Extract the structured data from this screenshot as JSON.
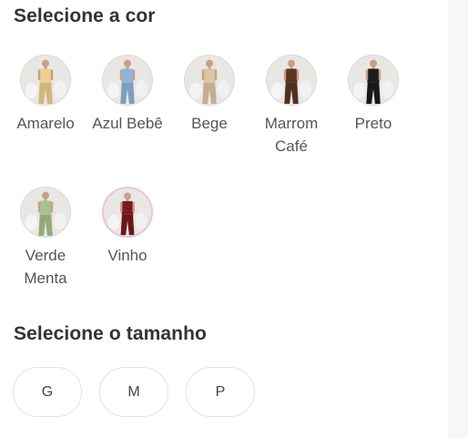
{
  "color_section": {
    "title": "Selecione a cor",
    "options": [
      {
        "label": "Amarelo",
        "color": "#ecd08e",
        "selected": false
      },
      {
        "label": "Azul Bebê",
        "color": "#8fb4dc",
        "selected": false
      },
      {
        "label": "Bege",
        "color": "#ddc6a6",
        "selected": false
      },
      {
        "label": "Marrom Café",
        "color": "#5a3724",
        "selected": false
      },
      {
        "label": "Preto",
        "color": "#1c1c1c",
        "selected": false
      },
      {
        "label": "Verde Menta",
        "color": "#a8c28e",
        "selected": false
      },
      {
        "label": "Vinho",
        "color": "#7a1b22",
        "selected": true
      }
    ]
  },
  "size_section": {
    "title": "Selecione o tamanho",
    "options": [
      "G",
      "M",
      "P"
    ]
  }
}
